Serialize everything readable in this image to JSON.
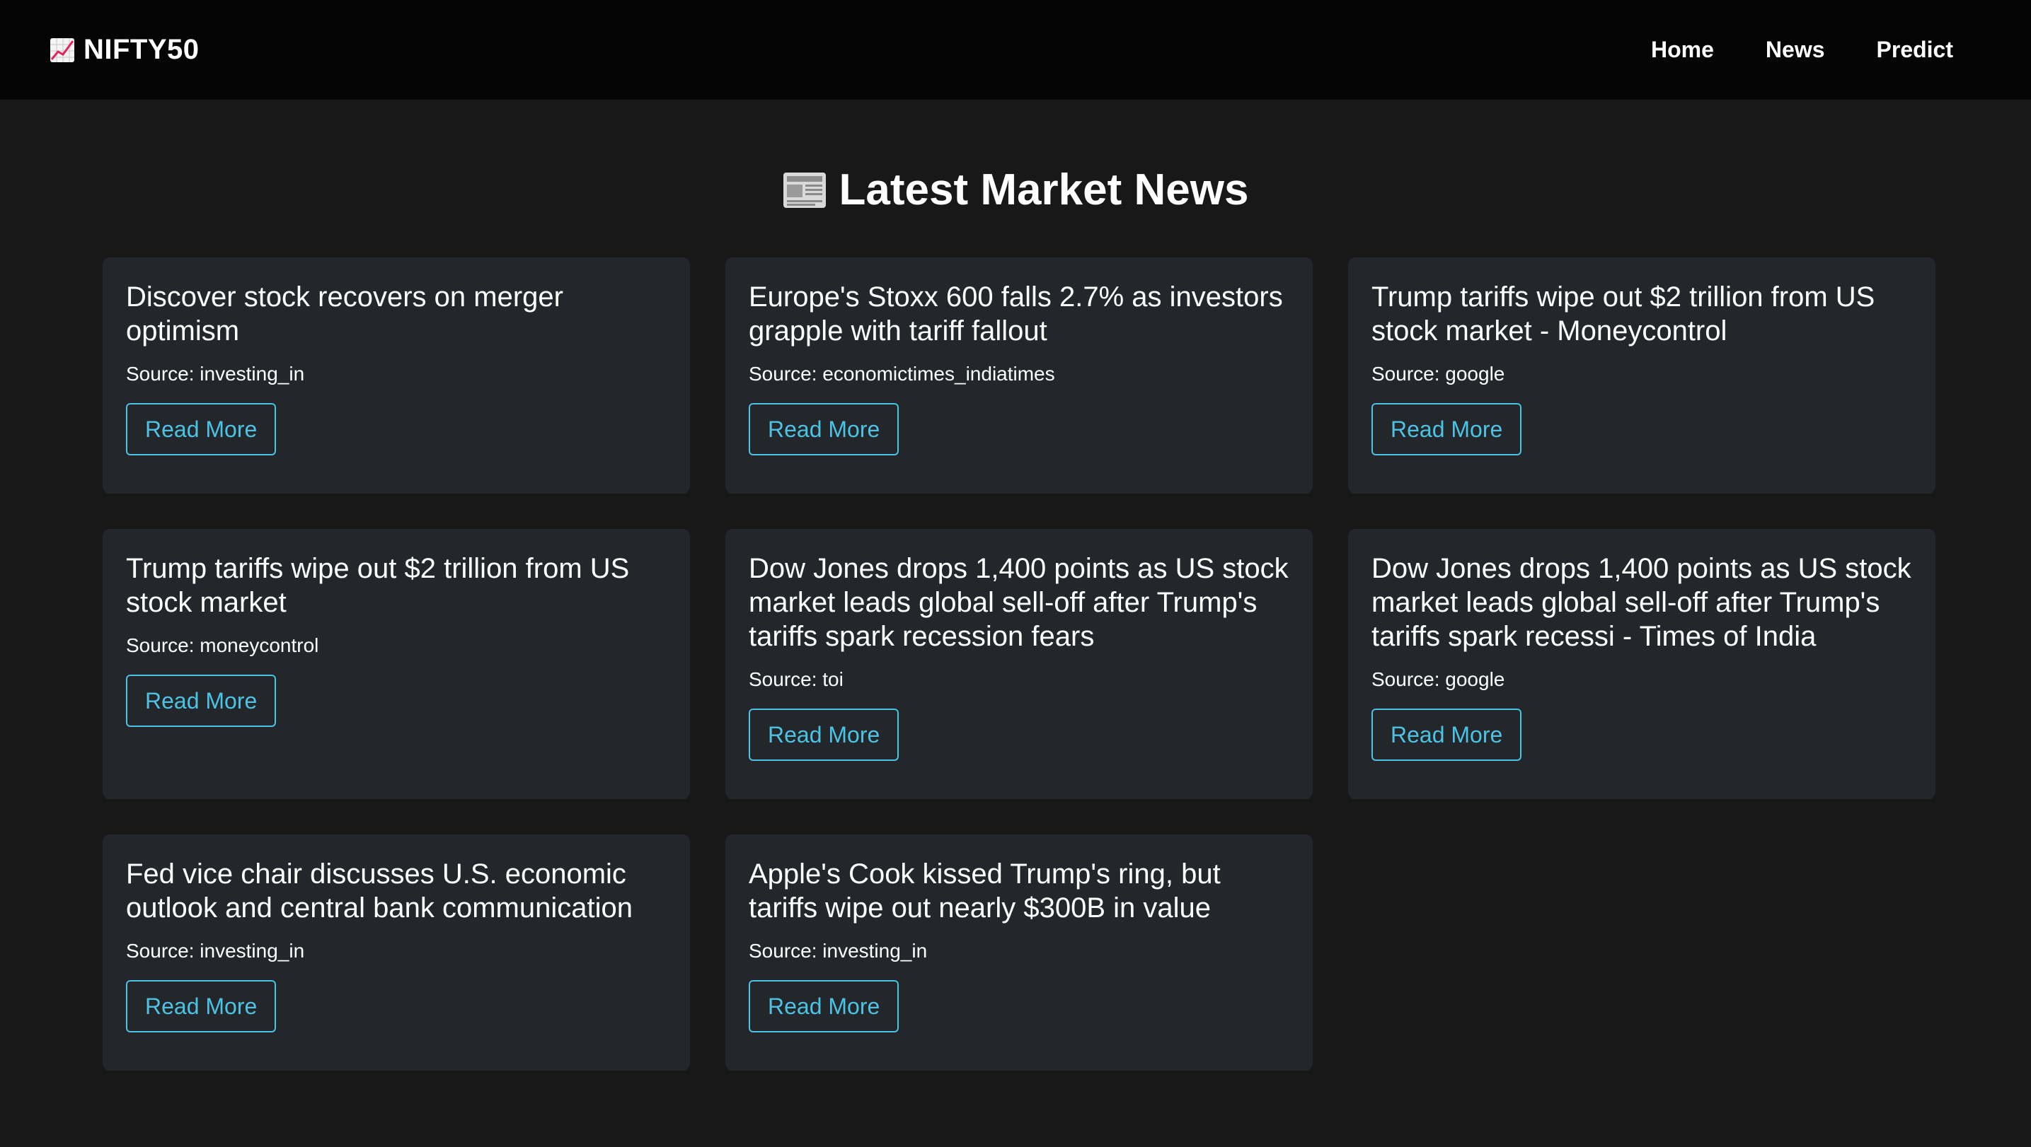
{
  "navbar": {
    "brand": "NIFTY50",
    "brand_icon": "chart-increasing-icon",
    "links": [
      {
        "label": "Home"
      },
      {
        "label": "News"
      },
      {
        "label": "Predict"
      }
    ]
  },
  "main": {
    "title": "Latest Market News",
    "title_icon": "newspaper-icon",
    "read_more_label": "Read More",
    "articles": [
      {
        "title": "Discover stock recovers on merger optimism",
        "source": "Source: investing_in"
      },
      {
        "title": "Europe's Stoxx 600 falls 2.7% as investors grapple with tariff fallout",
        "source": "Source: economictimes_indiatimes"
      },
      {
        "title": "Trump tariffs wipe out $2 trillion from US stock market - Moneycontrol",
        "source": "Source: google"
      },
      {
        "title": "Trump tariffs wipe out $2 trillion from US stock market",
        "source": "Source: moneycontrol"
      },
      {
        "title": "Dow Jones drops 1,400 points as US stock market leads global sell-off after Trump's tariffs spark recession fears",
        "source": "Source: toi"
      },
      {
        "title": "Dow Jones drops 1,400 points as US stock market leads global sell-off after Trump's tariffs spark recessi - Times of India",
        "source": "Source: google"
      },
      {
        "title": "Fed vice chair discusses U.S. economic outlook and central bank communication",
        "source": "Source: investing_in"
      },
      {
        "title": "Apple's Cook kissed Trump's ring, but tariffs wipe out nearly $300B in value",
        "source": "Source: investing_in"
      }
    ]
  },
  "colors": {
    "background": "#181818",
    "navbar": "#050505",
    "card": "#23262b",
    "accent": "#4cc3e3"
  }
}
